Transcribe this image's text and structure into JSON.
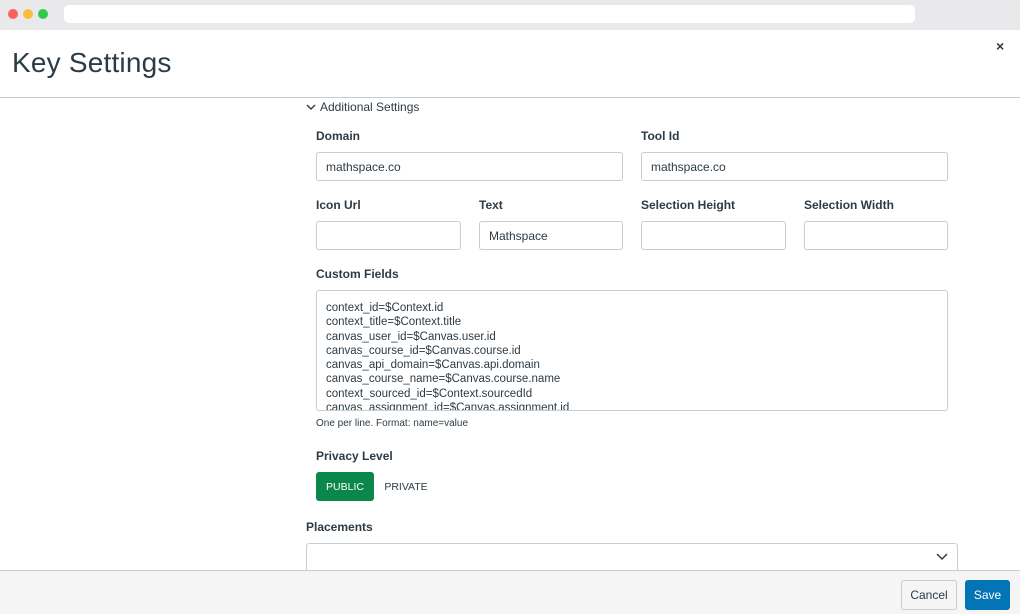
{
  "modal": {
    "title": "Key Settings",
    "close_label": "×"
  },
  "additional_settings": {
    "toggle_label": "Additional Settings"
  },
  "fields": {
    "domain": {
      "label": "Domain",
      "value": "mathspace.co"
    },
    "tool_id": {
      "label": "Tool Id",
      "value": "mathspace.co"
    },
    "icon_url": {
      "label": "Icon Url",
      "value": ""
    },
    "text": {
      "label": "Text",
      "value": "Mathspace"
    },
    "selection_height": {
      "label": "Selection Height",
      "value": ""
    },
    "selection_width": {
      "label": "Selection Width",
      "value": ""
    }
  },
  "custom_fields": {
    "label": "Custom Fields",
    "lines": [
      "context_id=$Context.id",
      "context_title=$Context.title",
      "canvas_user_id=$Canvas.user.id",
      "canvas_course_id=$Canvas.course.id",
      "canvas_api_domain=$Canvas.api.domain",
      "canvas_course_name=$Canvas.course.name",
      "context_sourced_id=$Context.sourcedId",
      "canvas_assignment_id=$Canvas.assignment.id"
    ],
    "hint": "One per line. Format: name=value"
  },
  "privacy": {
    "label": "Privacy Level",
    "options": [
      "PUBLIC",
      "PRIVATE"
    ],
    "selected": "PUBLIC",
    "selected_color": "#0b874b"
  },
  "placements": {
    "label": "Placements",
    "value": ""
  },
  "footer": {
    "cancel_label": "Cancel",
    "save_label": "Save",
    "save_color": "#0374b5"
  },
  "icons": {
    "toggle": "chevron-down-icon",
    "select": "chevron-down-icon",
    "close": "close-icon"
  }
}
